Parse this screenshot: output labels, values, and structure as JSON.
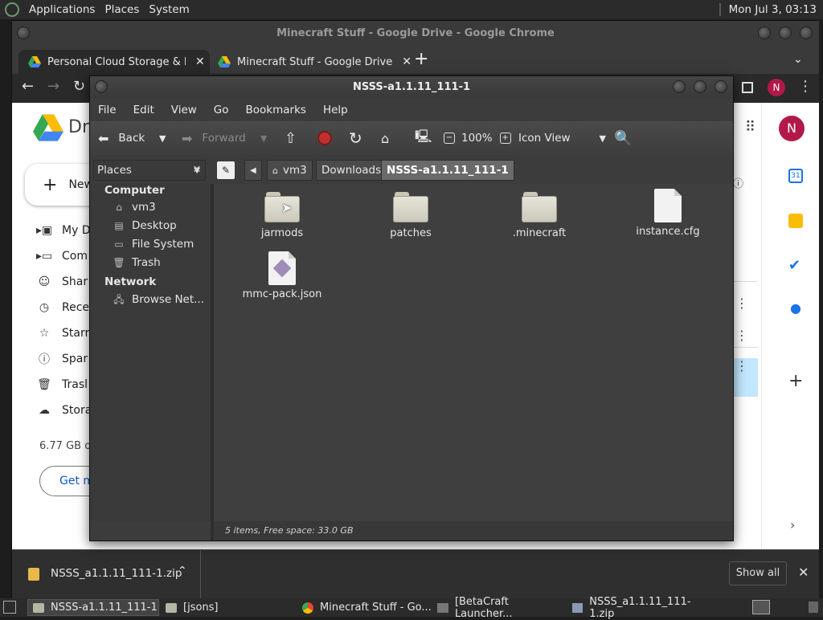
{
  "top_panel": {
    "menus": [
      "Applications",
      "Places",
      "System"
    ],
    "clock": "Mon Jul 3, 03:13"
  },
  "chrome": {
    "window_title": "Minecraft Stuff - Google Drive - Google Chrome",
    "tabs": [
      {
        "label": "Personal Cloud Storage & File"
      },
      {
        "label": "Minecraft Stuff - Google Drive"
      }
    ],
    "new_tab": "+",
    "profile_initial": "N"
  },
  "drive": {
    "logo_text": "Dri",
    "new_button": "New",
    "sidebar": [
      "My D",
      "Com",
      "Shar",
      "Rece",
      "Starr",
      "Spar",
      "Trasl",
      "Stora"
    ],
    "storage_used": "6.77 GB of",
    "get_more": "Get m",
    "avatar": "N"
  },
  "downloads": {
    "file": "NSSS_a1.1.11_111-1.zip",
    "show_all": "Show all"
  },
  "file_manager": {
    "title": "NSSS-a1.1.11_111-1",
    "menu": [
      "File",
      "Edit",
      "View",
      "Go",
      "Bookmarks",
      "Help"
    ],
    "toolbar": {
      "back": "Back",
      "forward": "Forward",
      "zoom": "100%",
      "view_mode": "Icon View"
    },
    "places_label": "Places",
    "path": [
      "vm3",
      "Downloads",
      "NSSS-a1.1.11_111-1"
    ],
    "sidebar": {
      "computer_head": "Computer",
      "computer_items": [
        "vm3",
        "Desktop",
        "File System",
        "Trash"
      ],
      "network_head": "Network",
      "network_items": [
        "Browse Net..."
      ]
    },
    "files": [
      {
        "name": "jarmods",
        "kind": "folder"
      },
      {
        "name": "patches",
        "kind": "folder"
      },
      {
        "name": ".minecraft",
        "kind": "folder"
      },
      {
        "name": "instance.cfg",
        "kind": "file"
      },
      {
        "name": "mmc-pack.json",
        "kind": "json"
      }
    ],
    "status": "5 items, Free space: 33.0 GB"
  },
  "taskbar": {
    "tasks": [
      "NSSS-a1.1.11_111-1",
      "[jsons]",
      "Minecraft Stuff - Go...",
      "[BetaCraft Launcher...",
      "NSSS_a1.1.11_111-1.zip"
    ]
  }
}
